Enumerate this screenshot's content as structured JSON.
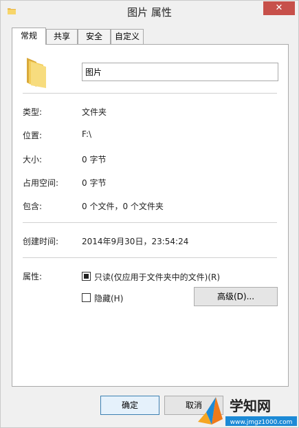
{
  "window": {
    "title": "图片 属性",
    "close_symbol": "✕"
  },
  "tabs": [
    {
      "label": "常规",
      "active": true
    },
    {
      "label": "共享",
      "active": false
    },
    {
      "label": "安全",
      "active": false
    },
    {
      "label": "自定义",
      "active": false
    }
  ],
  "general": {
    "folder_name": "图片",
    "rows": [
      {
        "label": "类型:",
        "value": "文件夹"
      },
      {
        "label": "位置:",
        "value": "F:\\"
      },
      {
        "label": "大小:",
        "value": "0 字节"
      },
      {
        "label": "占用空间:",
        "value": "0 字节"
      },
      {
        "label": "包含:",
        "value": "0 个文件，0 个文件夹"
      }
    ],
    "created_label": "创建时间:",
    "created_value": "2014年9月30日，23:54:24",
    "attributes_label": "属性:",
    "readonly_label": "只读(仅应用于文件夹中的文件)(R)",
    "readonly_state": "indeterminate",
    "hidden_label": "隐藏(H)",
    "hidden_checked": false,
    "advanced_label": "高级(D)..."
  },
  "buttons": {
    "ok": "确定",
    "cancel": "取消"
  },
  "watermark": {
    "brand": "学知网",
    "url": "www.jmgz1000.com"
  },
  "colors": {
    "close_button": "#c7504a",
    "folder": "#f2c94c",
    "watermark_orange": "#f5a623",
    "watermark_blue": "#1c8ad6"
  },
  "icons": {
    "title": "folder-icon",
    "main": "folder-icon"
  }
}
